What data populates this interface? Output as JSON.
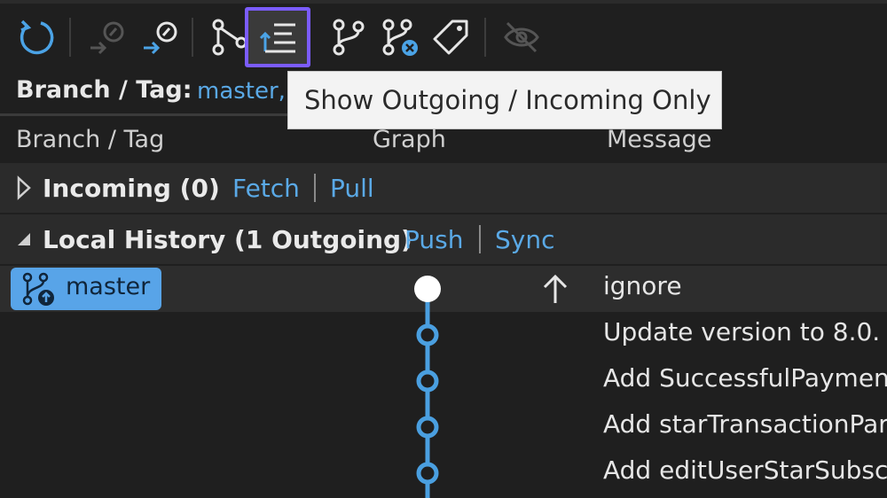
{
  "toolbar": {
    "buttons": [
      {
        "icon": "refresh-icon",
        "enabled": true
      },
      {
        "icon": "fetch-icon",
        "enabled": false
      },
      {
        "icon": "pull-icon",
        "enabled": true
      },
      {
        "icon": "graph-icon",
        "enabled": true
      },
      {
        "icon": "outgoing-incoming-icon",
        "enabled": true,
        "active": true
      },
      {
        "icon": "branch-icon",
        "enabled": true
      },
      {
        "icon": "remote-branch-icon",
        "enabled": true
      },
      {
        "icon": "tag-icon",
        "enabled": true
      },
      {
        "icon": "eye-hidden-icon",
        "enabled": false
      }
    ]
  },
  "tooltip": {
    "text": "Show Outgoing / Incoming Only"
  },
  "branch_filter": {
    "label": "Branch / Tag:",
    "value": "master,"
  },
  "columns": {
    "branch": "Branch / Tag",
    "graph": "Graph",
    "message": "Message"
  },
  "incoming": {
    "title": "Incoming (0)",
    "fetch": "Fetch",
    "pull": "Pull"
  },
  "local": {
    "title": "Local History (1 Outgoing)",
    "push": "Push",
    "sync": "Sync"
  },
  "commits": [
    {
      "branch": "master",
      "message": "ignore",
      "outgoing": true
    },
    {
      "message": "Update version to 8.0."
    },
    {
      "message": "Add SuccessfulPaymen"
    },
    {
      "message": "Add starTransactionPart"
    },
    {
      "message": "Add editUserStarSubscr"
    }
  ],
  "colors": {
    "accent": "#5aa9e6",
    "focus": "#7b5cff",
    "graph": "#4a9fe0"
  }
}
